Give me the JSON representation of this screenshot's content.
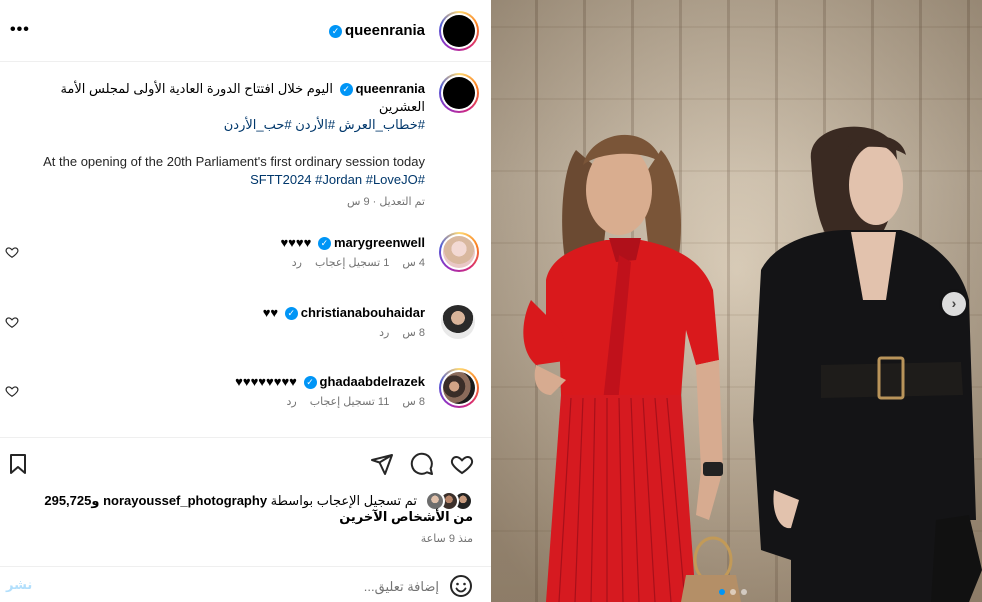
{
  "header": {
    "username": "queenrania",
    "more_icon": "more-horizontal-icon"
  },
  "caption": {
    "username": "queenrania",
    "text_ar": "اليوم خلال افتتاح الدورة العادية الأولى لمجلس الأمة العشرين",
    "hashtags_ar": "#خطاب_العرش #الأردن #حب_الأردن",
    "text_en": "At the opening of the 20th Parliament's first ordinary session today",
    "hashtags_en": "SFTT2024 #Jordan #LoveJO#",
    "meta": "تم التعديل · 9 س"
  },
  "comments": [
    {
      "username": "marygreenwell",
      "text": "♥♥♥♥",
      "time": "4 س",
      "likes": "1 تسجيل إعجاب",
      "reply": "رد"
    },
    {
      "username": "christianabouhaidar",
      "text": "♥♥",
      "time": "8 س",
      "likes": "",
      "reply": "رد"
    },
    {
      "username": "ghadaabdelrazek",
      "text": "♥♥♥♥♥♥♥♥",
      "time": "8 س",
      "likes": "11 تسجيل إعجاب",
      "reply": "رد"
    }
  ],
  "likes": {
    "prefix": "تم تسجيل الإعجاب بواسطة",
    "user": "norayoussef_photography",
    "suffix": "و295,725 من الأشخاص الآخرين"
  },
  "time_ago": "منذ 9 ساعة",
  "add_comment": {
    "placeholder": "إضافة تعليق...",
    "post_label": "نشر"
  },
  "carousel": {
    "current": 1,
    "total": 3
  },
  "colors": {
    "accent": "#0095f6",
    "link": "#00376b",
    "muted": "#737373"
  }
}
